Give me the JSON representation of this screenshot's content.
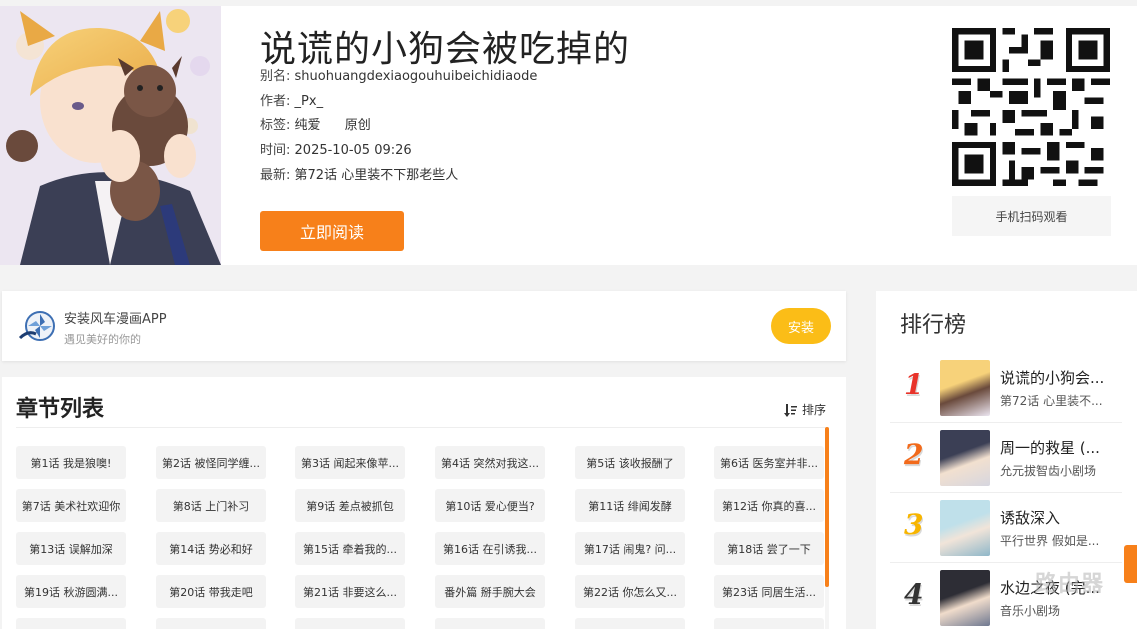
{
  "comic": {
    "title": "说谎的小狗会被吃掉的",
    "alias_label": "别名:",
    "alias": "shuohuangdexiaogouhuibeichidiaode",
    "author_label": "作者:",
    "author": "_Px_",
    "tags_label": "标签:",
    "tags": [
      "纯爱",
      "原创"
    ],
    "time_label": "时间:",
    "time": "2025-10-05 09:26",
    "latest_label": "最新:",
    "latest": "第72话 心里装不下那老些人",
    "read_button": "立即阅读",
    "scan_label": "手机扫码观看"
  },
  "app_banner": {
    "name": "安装风车漫画APP",
    "slogan": "遇见美好的你的",
    "install_button": "安装"
  },
  "chapters": {
    "title": "章节列表",
    "sort_label": "排序",
    "items": [
      "第1话 我是狼噢!",
      "第2话 被怪同学缠...",
      "第3话 闻起来像苹...",
      "第4话 突然对我这...",
      "第5话 该收报酬了",
      "第6话 医务室并非...",
      "第7话 美术社欢迎你",
      "第8话 上门补习",
      "第9话 差点被抓包",
      "第10话 爱心便当?",
      "第11话 绯闻发酵",
      "第12话 你真的喜...",
      "第13话 误解加深",
      "第14话 势必和好",
      "第15话 牵着我的...",
      "第16话 在引诱我...",
      "第17话 闹鬼? 问...",
      "第18话 尝了一下",
      "第19话 秋游圆满...",
      "第20话 带我走吧",
      "第21话 非要这么...",
      "番外篇 掰手腕大会",
      "第22话 你怎么又...",
      "第23话 同居生活..."
    ]
  },
  "ranking": {
    "title": "排行榜",
    "items": [
      {
        "rank": "1",
        "name": "说谎的小狗会...",
        "sub": "第72话 心里装不...",
        "color": "#e8332a"
      },
      {
        "rank": "2",
        "name": "周一的救星 (...",
        "sub": "允元拔智齿小剧场",
        "color": "#f26a1b"
      },
      {
        "rank": "3",
        "name": "诱敌深入",
        "sub": "平行世界 假如是...",
        "color": "#f7b500"
      },
      {
        "rank": "4",
        "name": "水边之夜 (完...",
        "sub": "音乐小剧场",
        "color": "#333333"
      }
    ]
  },
  "colors": {
    "accent": "#f7801a",
    "install": "#fbbd17"
  },
  "watermark": "路由器"
}
